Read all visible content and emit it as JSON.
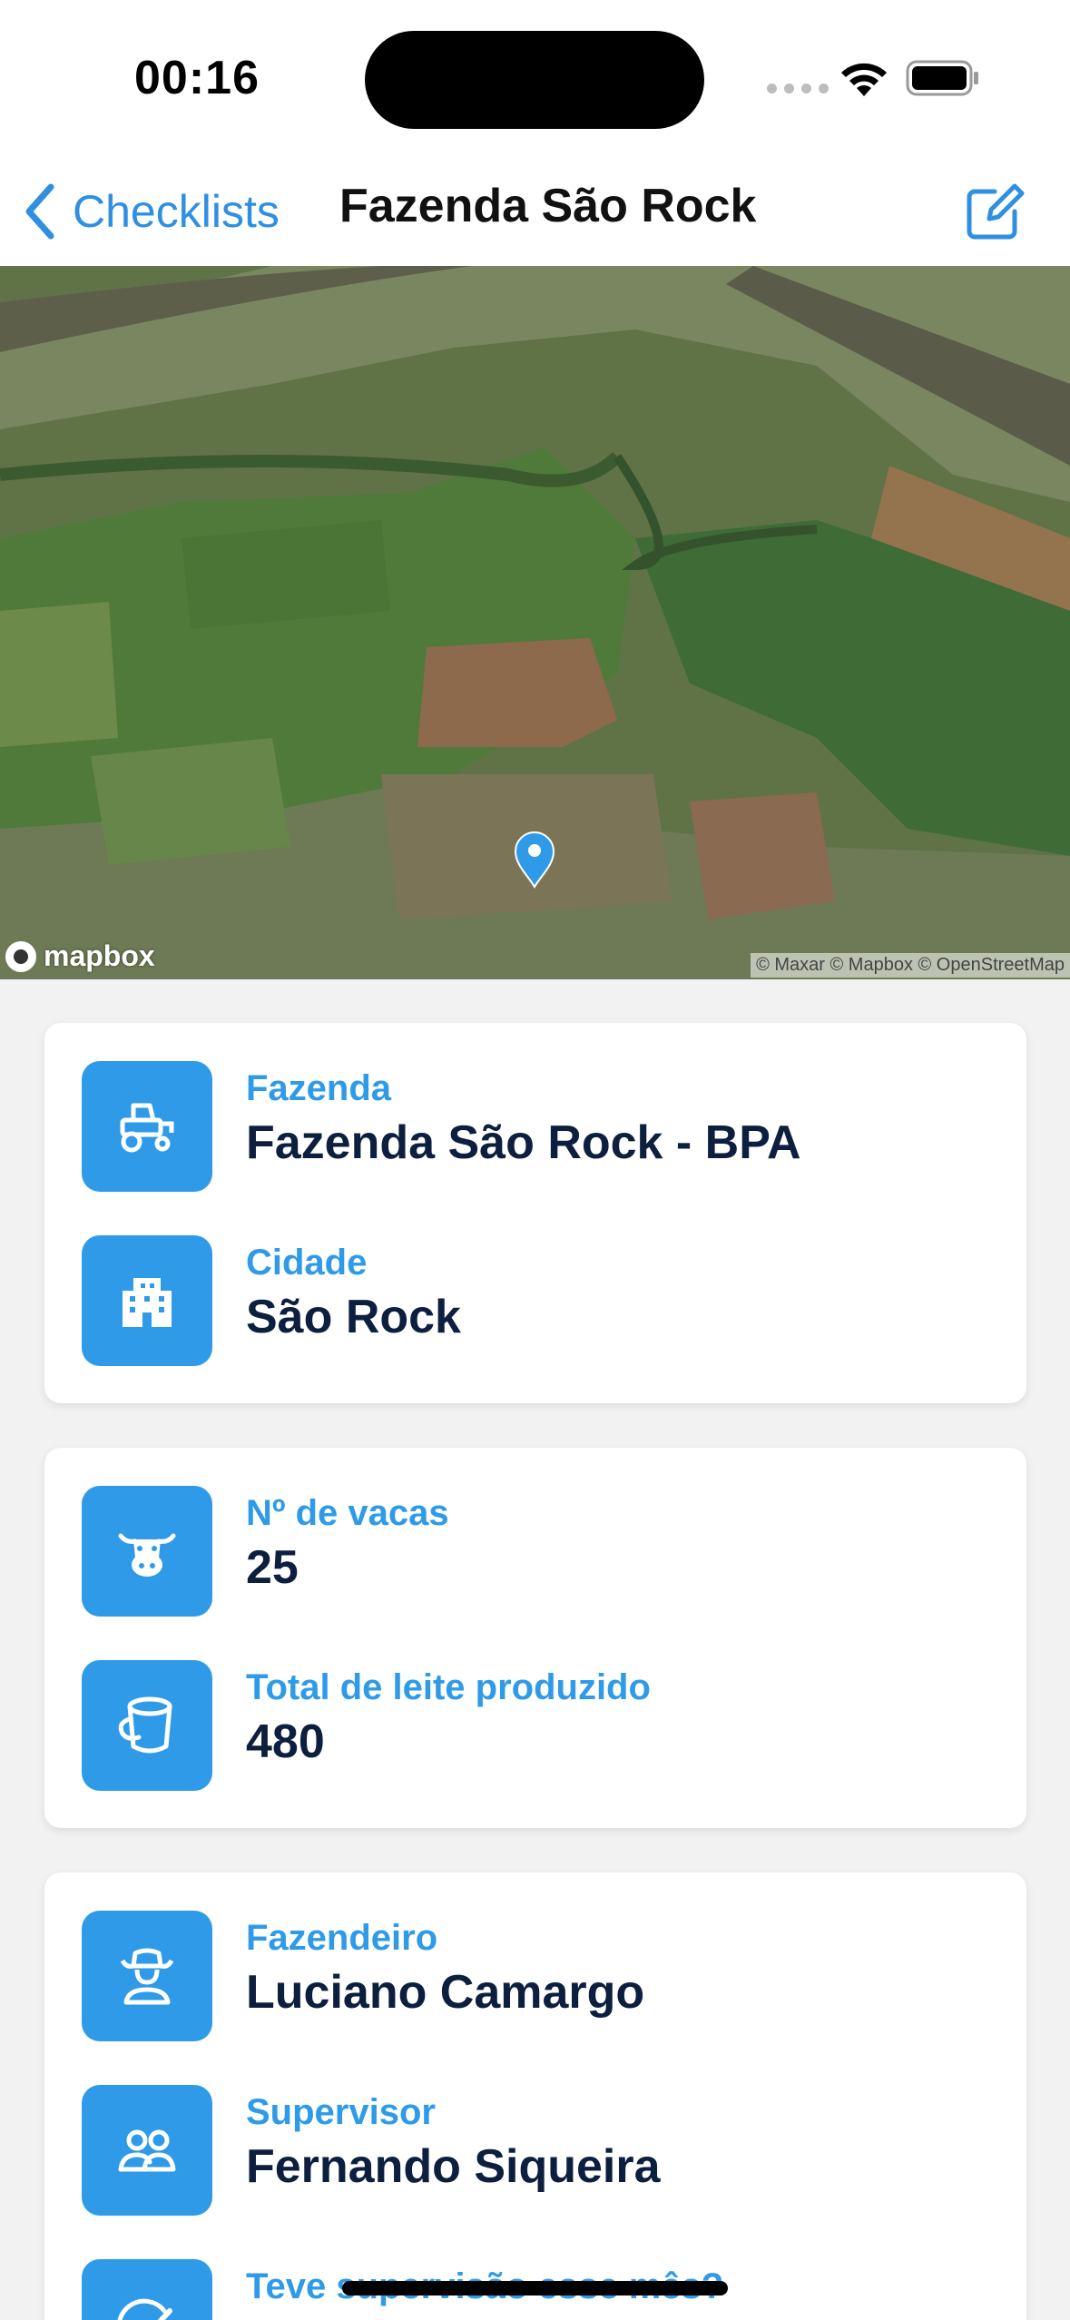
{
  "status_bar": {
    "time": "00:16"
  },
  "nav": {
    "back_label": "Checklists",
    "title": "Fazenda São Rock",
    "edit_icon": "square-pencil-icon"
  },
  "map": {
    "logo_label": "mapbox",
    "attribution": "© Maxar © Mapbox © OpenStreetMap"
  },
  "cards": {
    "location": {
      "farm": {
        "icon": "tractor-icon",
        "label": "Fazenda",
        "value": "Fazenda São Rock - BPA"
      },
      "city": {
        "icon": "building-icon",
        "label": "Cidade",
        "value": "São Rock"
      }
    },
    "production": {
      "cows": {
        "icon": "cow-icon",
        "label": "Nº de vacas",
        "value": "25"
      },
      "milk": {
        "icon": "bucket-icon",
        "label": "Total de leite produzido",
        "value": "480"
      }
    },
    "people": {
      "farmer": {
        "icon": "farmer-icon",
        "label": "Fazendeiro",
        "value": "Luciano Camargo"
      },
      "supervisor": {
        "icon": "people-icon",
        "label": "Supervisor",
        "value": "Fernando Siqueira"
      },
      "supervision": {
        "icon": "check-gauge-icon",
        "label": "Teve supervisão esse mês?"
      }
    }
  },
  "colors": {
    "accent": "#2f9be8",
    "link": "#2f8fe0",
    "value_text": "#0d1f3f",
    "background": "#f2f2f2"
  }
}
